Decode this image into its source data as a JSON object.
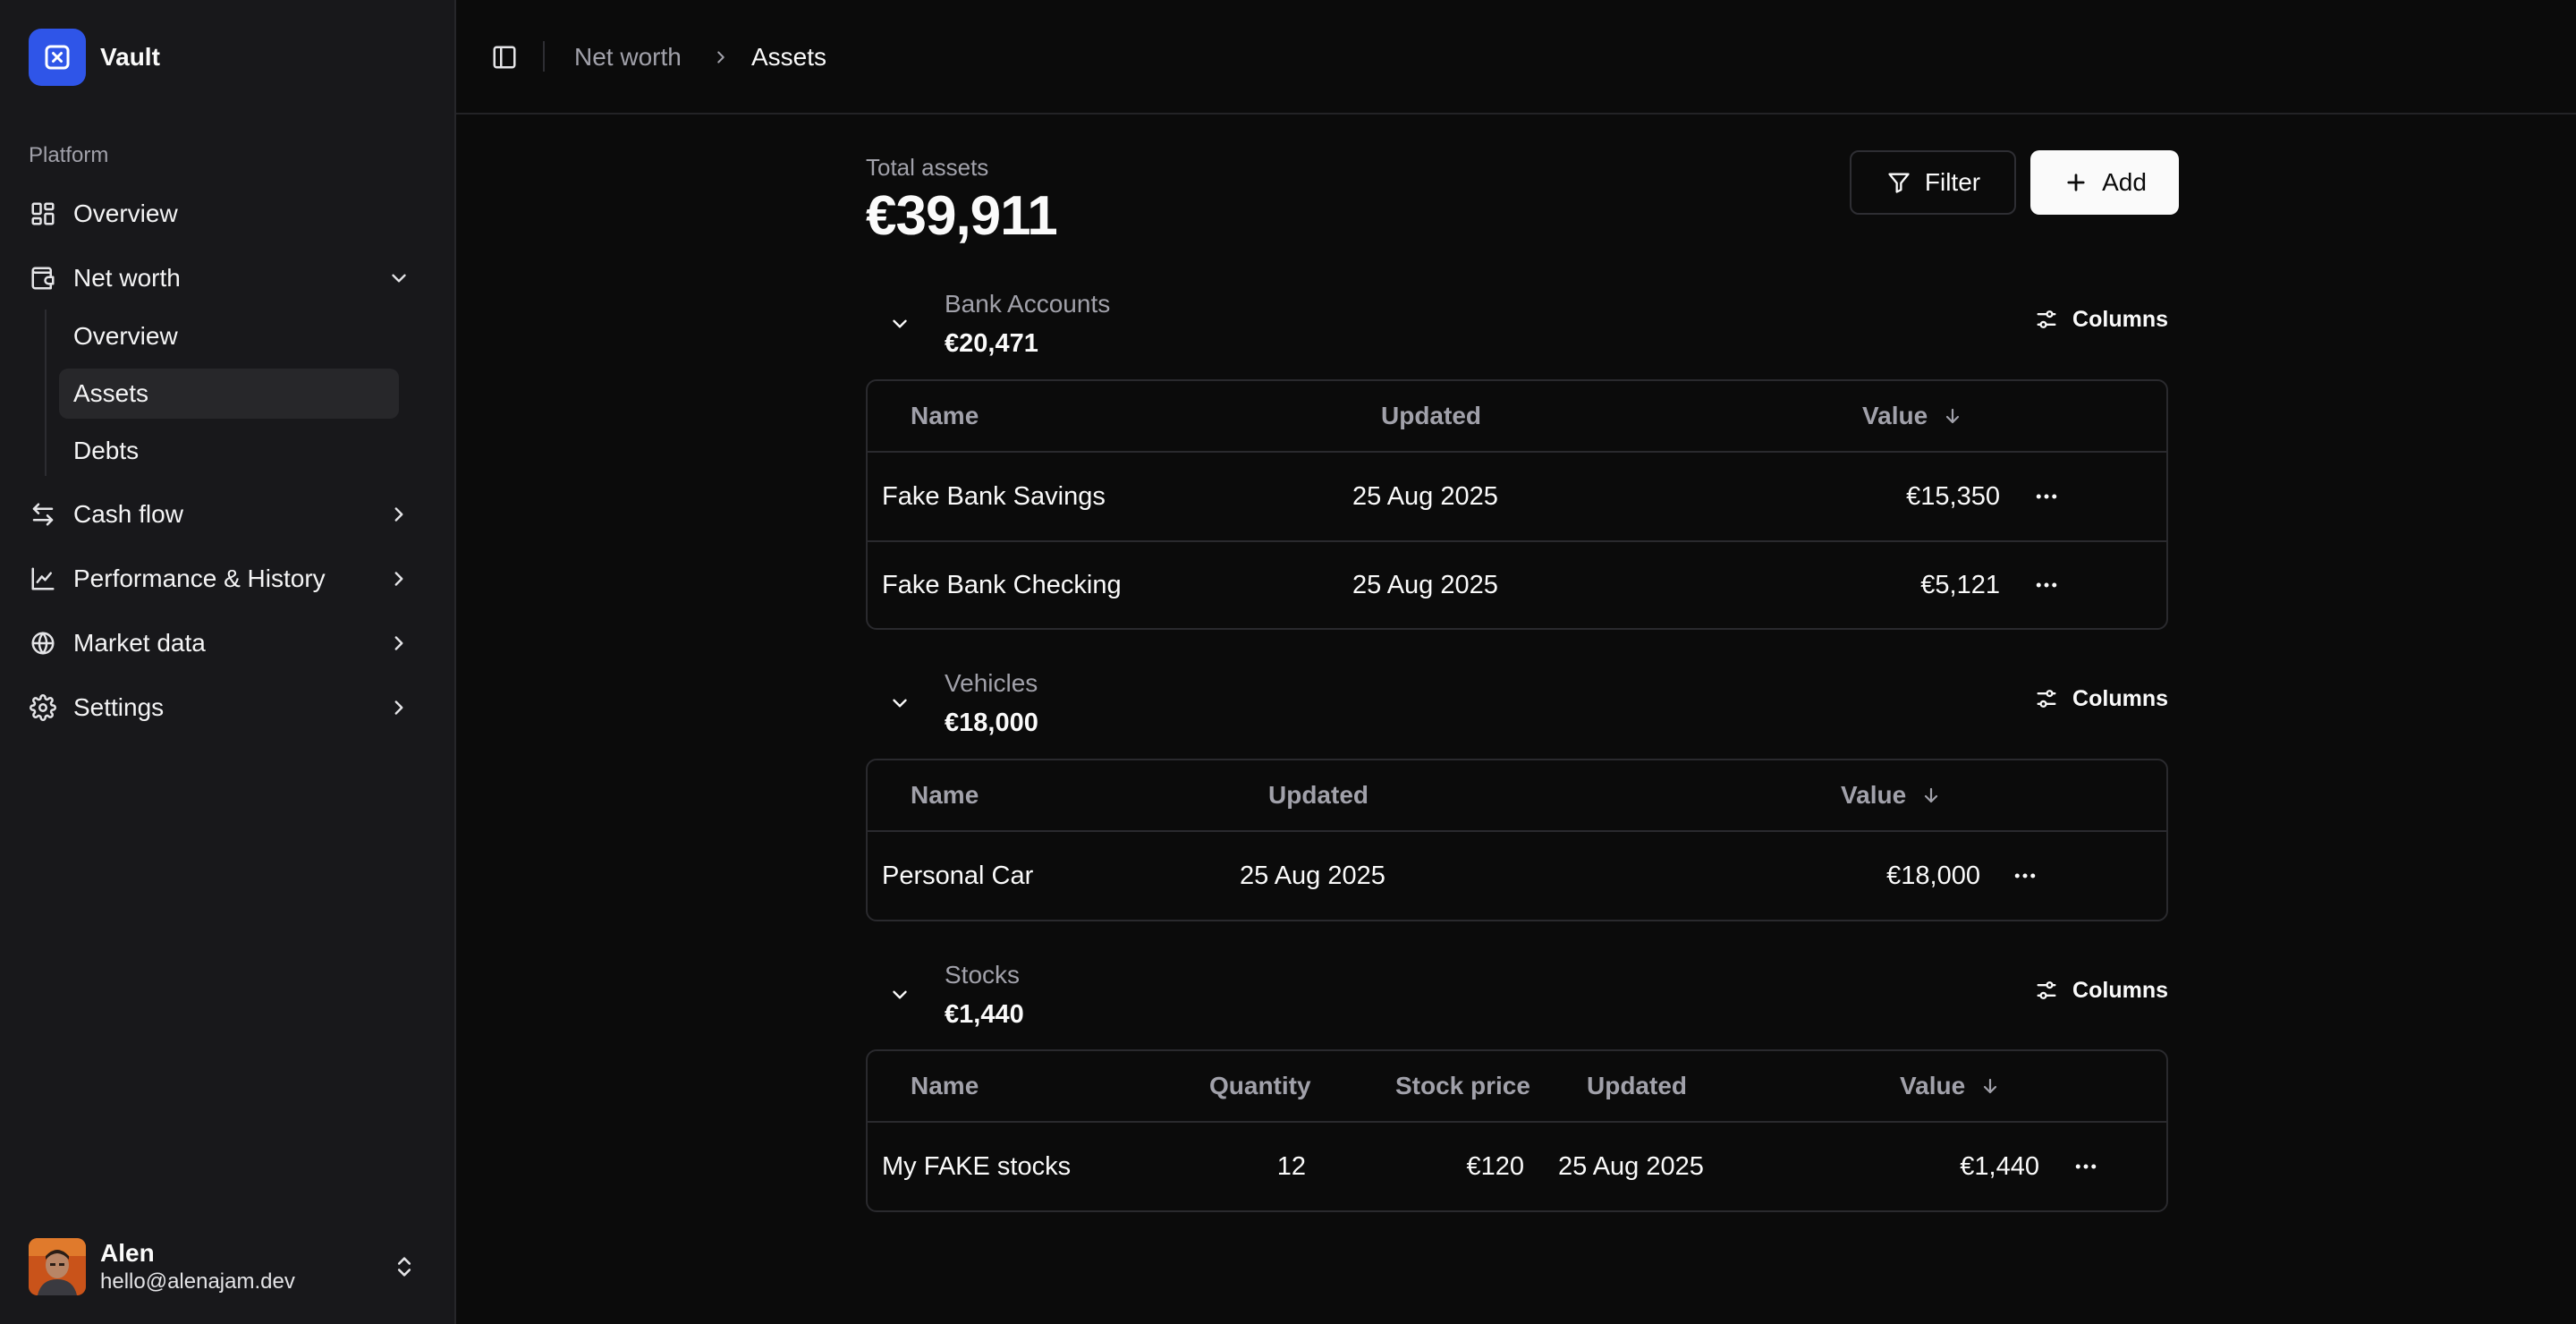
{
  "brand": {
    "name": "Vault",
    "logo_icon": "vault-x-icon",
    "accent": "#2f55e8"
  },
  "sidebar": {
    "section_label": "Platform",
    "items": [
      {
        "label": "Overview",
        "icon": "dashboard-grid-icon"
      },
      {
        "label": "Net worth",
        "icon": "wallet-icon",
        "expanded": true,
        "children": [
          {
            "label": "Overview"
          },
          {
            "label": "Assets",
            "active": true
          },
          {
            "label": "Debts"
          }
        ]
      },
      {
        "label": "Cash flow",
        "icon": "arrows-left-right-icon"
      },
      {
        "label": "Performance & History",
        "icon": "line-chart-icon"
      },
      {
        "label": "Market data",
        "icon": "globe-icon"
      },
      {
        "label": "Settings",
        "icon": "gear-icon"
      }
    ]
  },
  "user": {
    "name": "Alen",
    "email": "hello@alenajam.dev"
  },
  "breadcrumb": {
    "parent": "Net worth",
    "current": "Assets"
  },
  "summary": {
    "label": "Total assets",
    "value": "€39,911"
  },
  "actions": {
    "filter_label": "Filter",
    "add_label": "Add"
  },
  "groups": [
    {
      "name": "Bank Accounts",
      "total": "€20,471",
      "columns_label": "Columns",
      "headers": {
        "name": "Name",
        "updated": "Updated",
        "value": "Value"
      },
      "rows": [
        {
          "name": "Fake Bank Savings",
          "updated": "25 Aug 2025",
          "value": "€15,350"
        },
        {
          "name": "Fake Bank Checking",
          "updated": "25 Aug 2025",
          "value": "€5,121"
        }
      ]
    },
    {
      "name": "Vehicles",
      "total": "€18,000",
      "columns_label": "Columns",
      "headers": {
        "name": "Name",
        "updated": "Updated",
        "value": "Value"
      },
      "rows": [
        {
          "name": "Personal Car",
          "updated": "25 Aug 2025",
          "value": "€18,000"
        }
      ]
    },
    {
      "name": "Stocks",
      "total": "€1,440",
      "columns_label": "Columns",
      "headers": {
        "name": "Name",
        "quantity": "Quantity",
        "stock_price": "Stock price",
        "updated": "Updated",
        "value": "Value"
      },
      "rows": [
        {
          "name": "My FAKE stocks",
          "quantity": "12",
          "stock_price": "€120",
          "updated": "25 Aug 2025",
          "value": "€1,440"
        }
      ]
    }
  ]
}
